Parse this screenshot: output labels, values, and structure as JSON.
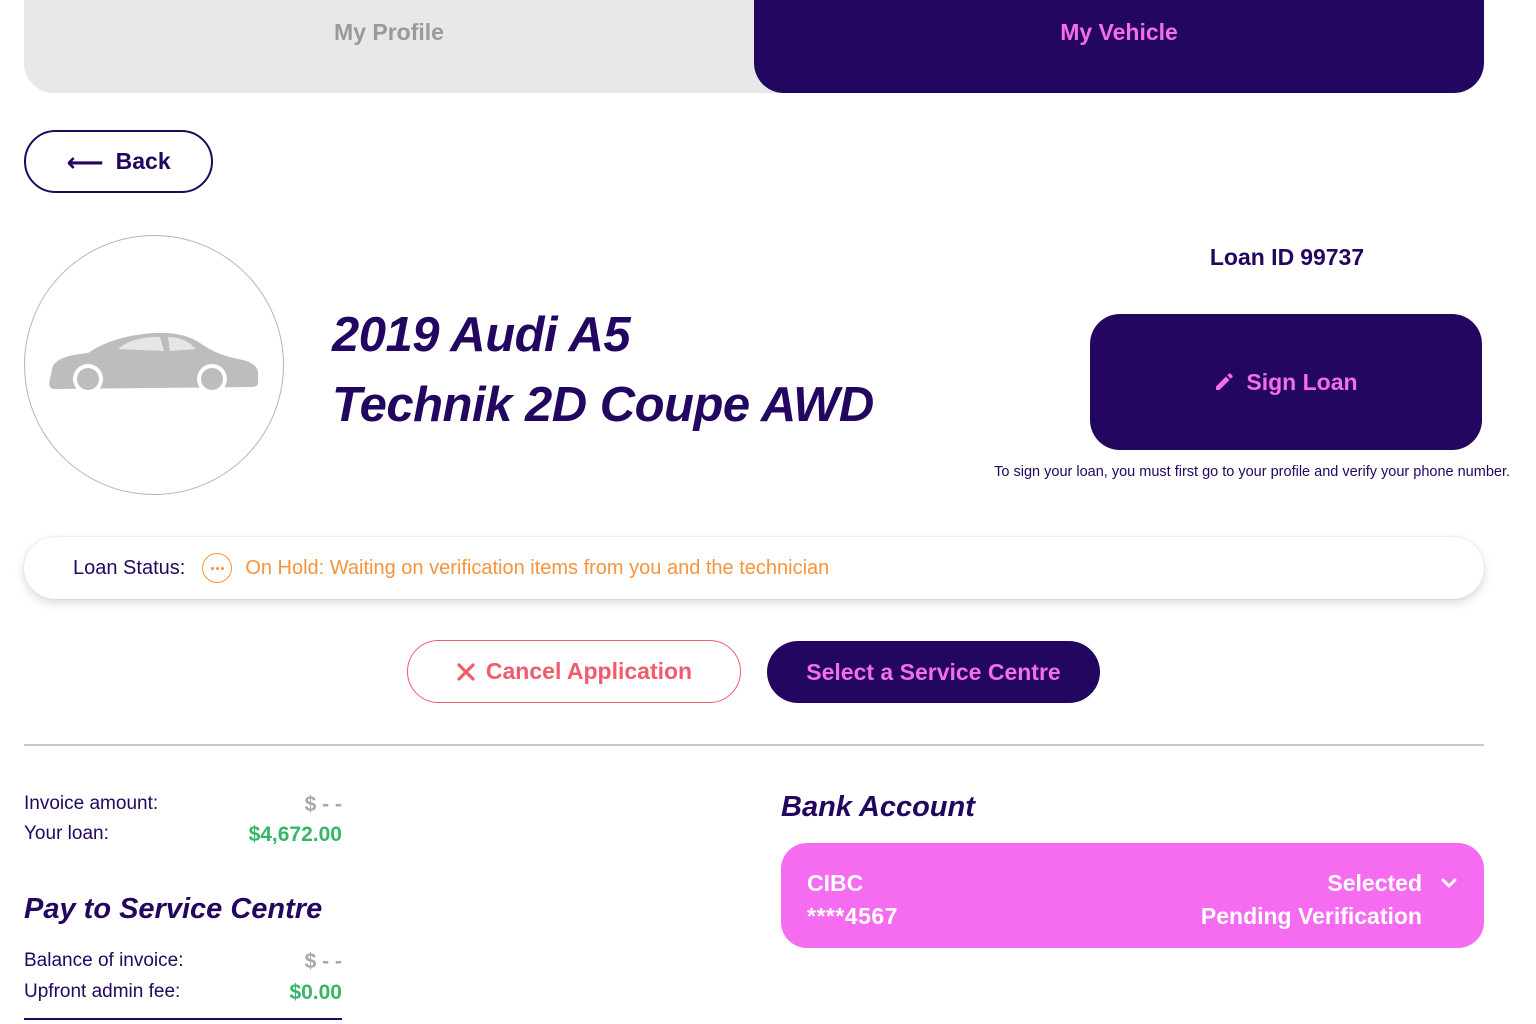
{
  "tabs": {
    "profile": "My Profile",
    "vehicle": "My Vehicle"
  },
  "nav": {
    "back_label": "Back"
  },
  "vehicle": {
    "title_line1": "2019 Audi A5",
    "title_line2": "Technik 2D Coupe AWD",
    "image_icon": "car-icon"
  },
  "loan": {
    "id_label": "Loan ID",
    "id_value": "99737",
    "sign_label": "Sign Loan",
    "sign_note": "To sign your loan, you must first go to your profile and verify your phone number."
  },
  "status": {
    "label": "Loan Status:",
    "text": "On Hold: Waiting on verification items from you and the technician",
    "color": "#f7933a"
  },
  "actions": {
    "cancel_label": "Cancel Application",
    "service_label": "Select a Service Centre"
  },
  "finance": {
    "invoice_label": "Invoice amount:",
    "invoice_value": "$ - -",
    "loan_label": "Your loan:",
    "loan_value": "$4,672.00"
  },
  "pay": {
    "title": "Pay to Service Centre",
    "balance_label": "Balance of invoice:",
    "balance_value": "$ - -",
    "fee_label": "Upfront admin fee:",
    "fee_value": "$0.00"
  },
  "bank": {
    "title": "Bank Account",
    "name": "CIBC",
    "number": "****4567",
    "selected": "Selected",
    "status": "Pending Verification"
  },
  "colors": {
    "navy": "#220660",
    "pink": "#f56cf0",
    "green": "#37b66a",
    "red": "#f05b6d",
    "orange": "#f7933a"
  }
}
